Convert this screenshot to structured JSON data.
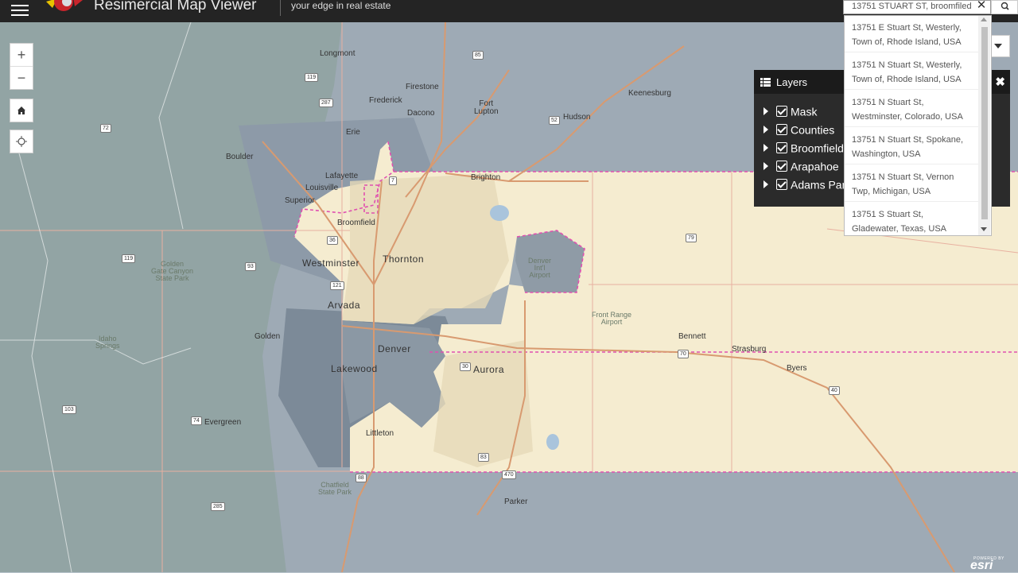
{
  "header": {
    "title": "Resimercial Map Viewer",
    "tagline": "your edge in real estate",
    "search_value": "13751 STUART ST, broomfiled"
  },
  "suggestions": [
    {
      "line1": "13751 E Stuart St, Westerly,",
      "line2": "Town of, Rhode Island, USA"
    },
    {
      "line1": "13751 N Stuart St, Westerly,",
      "line2": "Town of, Rhode Island, USA"
    },
    {
      "line1": "13751 N Stuart St,",
      "line2": "Westminster, Colorado, USA"
    },
    {
      "line1": "13751 N Stuart St, Spokane,",
      "line2": "Washington, USA"
    },
    {
      "line1": "13751 N Stuart St, Vernon",
      "line2": "Twp, Michigan, USA"
    },
    {
      "line1": "13751 S Stuart St,",
      "line2": "Gladewater, Texas, USA"
    }
  ],
  "layers_panel": {
    "title": "Layers",
    "items": [
      {
        "label": "Mask",
        "checked": true
      },
      {
        "label": "Counties",
        "checked": true
      },
      {
        "label": "Broomfield",
        "checked": true
      },
      {
        "label": "Arapahoe",
        "checked": true
      },
      {
        "label": "Adams Par",
        "checked": true
      }
    ]
  },
  "zoom": {
    "in": "+",
    "out": "−"
  },
  "map_labels": {
    "longmont": "Longmont",
    "firestone": "Firestone",
    "frederick": "Frederick",
    "dacono": "Dacono",
    "fort_lupton": "Fort\nLupton",
    "hudson": "Hudson",
    "keenesburg": "Keenesburg",
    "erie": "Erie",
    "boulder": "Boulder",
    "lafayette": "Lafayette",
    "louisville": "Louisville",
    "superior": "Superior",
    "brighton": "Brighton",
    "broomfield": "Broomfield",
    "westminster": "Westminster",
    "thornton": "Thornton",
    "denver_airport": "Denver\nInt'l\nAirport",
    "golden_gate": "Golden\nGate Canyon\nState Park",
    "arvada": "Arvada",
    "front_range_airport": "Front Range\nAirport",
    "bennett": "Bennett",
    "strasburg": "Strasburg",
    "idaho_springs": "Idaho\nSprings",
    "golden": "Golden",
    "denver": "Denver",
    "aurora": "Aurora",
    "lakewood": "Lakewood",
    "byers": "Byers",
    "evergreen": "Evergreen",
    "littleton": "Littleton",
    "chatfield": "Chatfield\nState Park",
    "parker": "Parker"
  },
  "route_shields": [
    "85",
    "119",
    "287",
    "52",
    "72",
    "7",
    "36",
    "93",
    "121",
    "119",
    "79",
    "70",
    "30",
    "40",
    "103",
    "74",
    "83",
    "470",
    "285",
    "88"
  ],
  "attribution": {
    "powered": "POWERED BY",
    "brand": "esri"
  },
  "colors": {
    "header_bg": "#242424",
    "mask_gray": "#9aa6b1",
    "county_beige": "#f5ecd0",
    "boundary_pink": "#e050b0",
    "panel_bg": "#2b2b2b"
  }
}
